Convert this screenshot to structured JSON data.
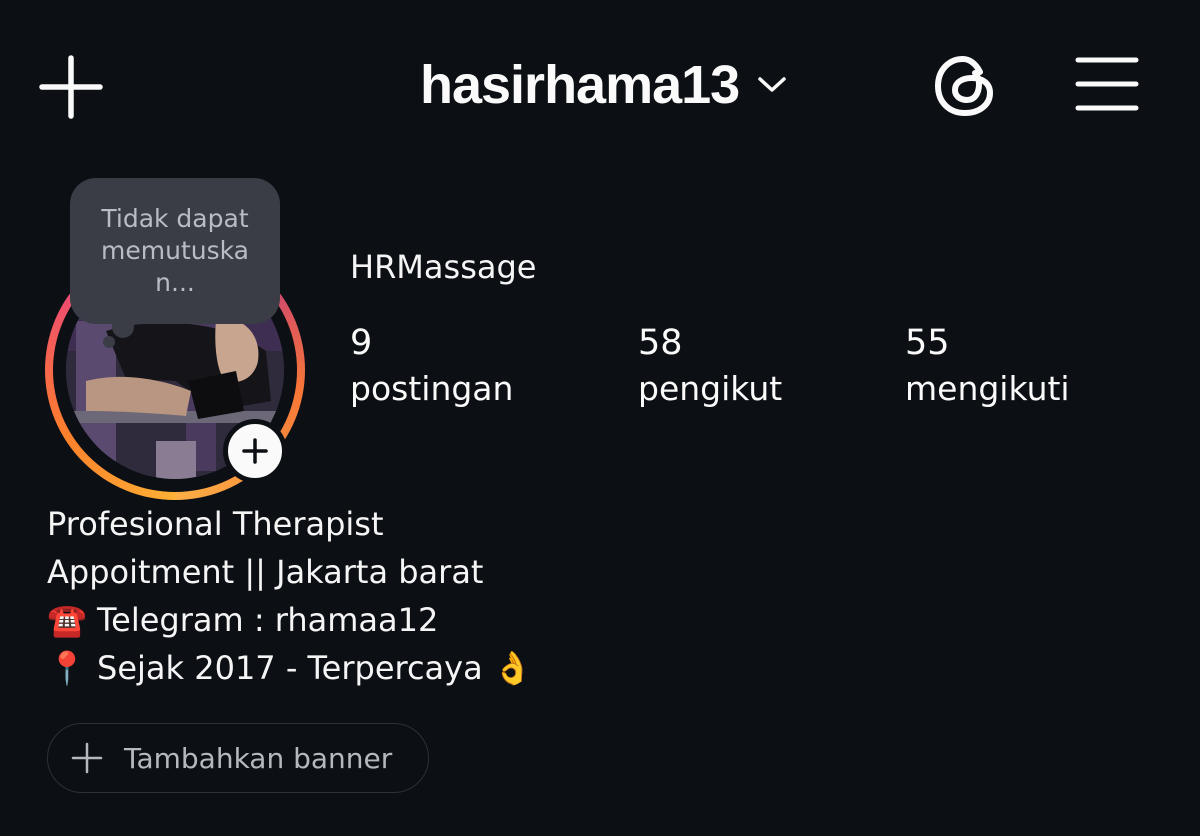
{
  "header": {
    "username": "hasirhama13"
  },
  "note": {
    "text": "Tidak dapat memutuskan..."
  },
  "profile": {
    "display_name": "HRMassage",
    "stats": [
      {
        "value": "9",
        "label": "postingan"
      },
      {
        "value": "58",
        "label": "pengikut"
      },
      {
        "value": "55",
        "label": "mengikuti"
      }
    ],
    "bio": [
      "Profesional Therapist",
      "Appoitment || Jakarta barat",
      "☎️ Telegram : rhamaa12",
      "📍 Sejak 2017 - Terpercaya 👌"
    ]
  },
  "actions": {
    "add_banner_label": "Tambahkan banner"
  },
  "icons": {
    "create": "plus-icon",
    "username_dropdown": "chevron-down-icon",
    "threads": "threads-icon",
    "menu": "hamburger-menu-icon",
    "add_story": "plus-icon",
    "add_banner": "plus-icon"
  },
  "colors": {
    "background": "#0c0f14",
    "note_bubble": "#3a3d45",
    "story_ring_start": "#fbb034",
    "story_ring_end": "#c13584"
  }
}
